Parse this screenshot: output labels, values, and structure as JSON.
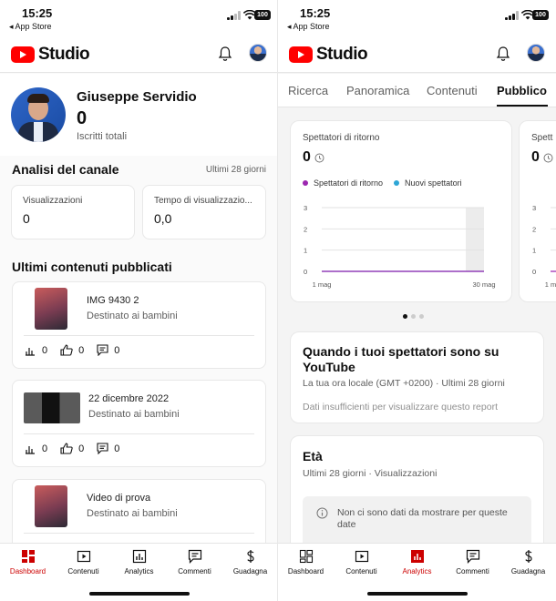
{
  "status_bar": {
    "time": "15:25",
    "back_label": "◂ App Store",
    "battery": "100"
  },
  "app": {
    "name": "Studio"
  },
  "left": {
    "channel": {
      "name": "Giuseppe Servidio",
      "subscribers": "0",
      "subscribers_label": "Iscritti totali"
    },
    "analytics": {
      "title": "Analisi del canale",
      "period": "Ultimi 28 giorni",
      "metrics": [
        {
          "label": "Visualizzazioni",
          "value": "0"
        },
        {
          "label": "Tempo di visualizzazio...",
          "value": "0,0"
        }
      ]
    },
    "latest": {
      "title": "Ultimi contenuti pubblicati",
      "videos": [
        {
          "title": "IMG 9430 2",
          "audience": "Destinato ai bambini",
          "views": "0",
          "likes": "0",
          "comments": "0"
        },
        {
          "title": "22 dicembre 2022",
          "audience": "Destinato ai bambini",
          "views": "0",
          "likes": "0",
          "comments": "0"
        },
        {
          "title": "Video di prova",
          "audience": "Destinato ai bambini"
        }
      ]
    }
  },
  "right": {
    "tabs": [
      "Ricerca",
      "Panoramica",
      "Contenuti",
      "Pubblico"
    ],
    "active_tab": "Pubblico",
    "returning_card": {
      "title": "Spettatori di ritorno",
      "value": "0",
      "legend": [
        {
          "name": "Spettatori di ritorno",
          "color": "#9c27b0"
        },
        {
          "name": "Nuovi spettatori",
          "color": "#2ea6d6"
        }
      ]
    },
    "peek_card": {
      "title": "Spett",
      "value": "0"
    },
    "when_card": {
      "title": "Quando i tuoi spettatori sono su YouTube",
      "meta": "La tua ora locale (GMT +0200) · Ultimi 28 giorni",
      "note": "Dati insufficienti per visualizzare questo report"
    },
    "age_card": {
      "title": "Età",
      "meta": "Ultimi 28 giorni · Visualizzazioni",
      "empty": "Non ci sono dati da mostrare per queste date"
    }
  },
  "nav": {
    "left": [
      "Dashboard",
      "Contenuti",
      "Analytics",
      "Commenti",
      "Guadagna"
    ],
    "right": [
      "Dashboard",
      "Contenuti",
      "Analytics",
      "Commenti",
      "Guadagna"
    ],
    "active_color": "#cc0000"
  },
  "chart_data": [
    {
      "type": "line",
      "title": "Spettatori di ritorno",
      "x": [
        "1 mag",
        "30 mag"
      ],
      "ylim": [
        0,
        3
      ],
      "yticks": [
        0,
        1,
        2,
        3
      ],
      "series": [
        {
          "name": "Spettatori di ritorno",
          "values": [
            0,
            0
          ]
        },
        {
          "name": "Nuovi spettatori",
          "values": [
            0,
            0
          ]
        }
      ],
      "grid": true
    },
    {
      "type": "line",
      "x": [
        "1 m"
      ],
      "yticks": [
        0,
        1,
        2,
        3
      ],
      "ylim": [
        0,
        3
      ],
      "series": [
        {
          "values": [
            0,
            0
          ]
        }
      ],
      "grid": true
    }
  ]
}
